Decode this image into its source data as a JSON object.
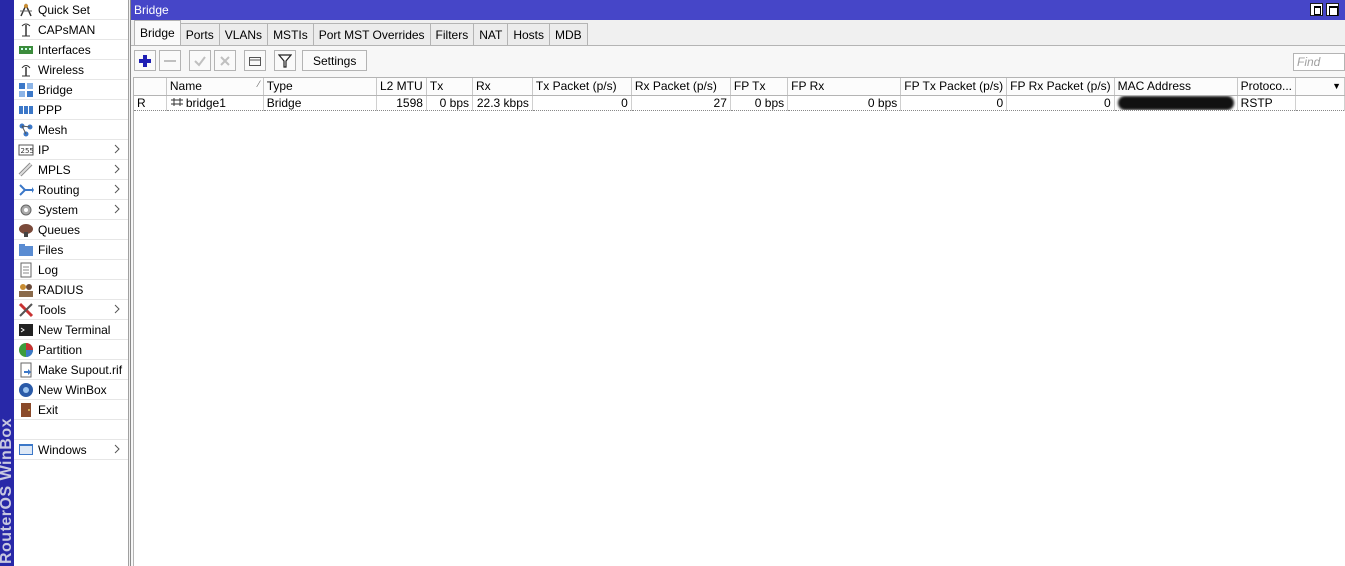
{
  "brand": "RouterOS WinBox",
  "menu": [
    {
      "label": "Quick Set",
      "icon": "quick-set-icon",
      "submenu": false
    },
    {
      "label": "CAPsMAN",
      "icon": "capsman-icon",
      "submenu": false
    },
    {
      "label": "Interfaces",
      "icon": "interfaces-icon",
      "submenu": false
    },
    {
      "label": "Wireless",
      "icon": "wireless-icon",
      "submenu": false
    },
    {
      "label": "Bridge",
      "icon": "bridge-icon",
      "submenu": false
    },
    {
      "label": "PPP",
      "icon": "ppp-icon",
      "submenu": false
    },
    {
      "label": "Mesh",
      "icon": "mesh-icon",
      "submenu": false
    },
    {
      "label": "IP",
      "icon": "ip-icon",
      "submenu": true
    },
    {
      "label": "MPLS",
      "icon": "mpls-icon",
      "submenu": true
    },
    {
      "label": "Routing",
      "icon": "routing-icon",
      "submenu": true
    },
    {
      "label": "System",
      "icon": "system-icon",
      "submenu": true
    },
    {
      "label": "Queues",
      "icon": "queues-icon",
      "submenu": false
    },
    {
      "label": "Files",
      "icon": "files-icon",
      "submenu": false
    },
    {
      "label": "Log",
      "icon": "log-icon",
      "submenu": false
    },
    {
      "label": "RADIUS",
      "icon": "radius-icon",
      "submenu": false
    },
    {
      "label": "Tools",
      "icon": "tools-icon",
      "submenu": true
    },
    {
      "label": "New Terminal",
      "icon": "terminal-icon",
      "submenu": false
    },
    {
      "label": "Partition",
      "icon": "partition-icon",
      "submenu": false
    },
    {
      "label": "Make Supout.rif",
      "icon": "supout-icon",
      "submenu": false
    },
    {
      "label": "New WinBox",
      "icon": "winbox-icon",
      "submenu": false
    },
    {
      "label": "Exit",
      "icon": "exit-icon",
      "submenu": false
    }
  ],
  "menu_bottom": {
    "label": "Windows",
    "icon": "windows-icon",
    "submenu": true
  },
  "window": {
    "title": "Bridge",
    "tabs": [
      "Bridge",
      "Ports",
      "VLANs",
      "MSTIs",
      "Port MST Overrides",
      "Filters",
      "NAT",
      "Hosts",
      "MDB"
    ],
    "active_tab": "Bridge",
    "settings_label": "Settings",
    "find_placeholder": "Find"
  },
  "table": {
    "columns": [
      "",
      "Name",
      "Type",
      "L2 MTU",
      "Tx",
      "Rx",
      "Tx Packet (p/s)",
      "Rx Packet (p/s)",
      "FP Tx",
      "FP Rx",
      "FP Tx Packet (p/s)",
      "FP Rx Packet (p/s)",
      "MAC Address",
      "Protoco...",
      ""
    ],
    "rows": [
      {
        "flag": "R",
        "name": "bridge1",
        "type": "Bridge",
        "l2mtu": "1598",
        "tx": "0 bps",
        "rx": "22.3 kbps",
        "tx_packet": "0",
        "rx_packet": "27",
        "fp_tx": "0 bps",
        "fp_rx": "0 bps",
        "fp_tx_packet": "0",
        "fp_rx_packet": "0",
        "mac": "",
        "protocol": "RSTP"
      }
    ]
  },
  "colors": {
    "titlebar": "#4646c8",
    "brandbar": "#2828a8",
    "add_icon": "#1e1eb4"
  }
}
